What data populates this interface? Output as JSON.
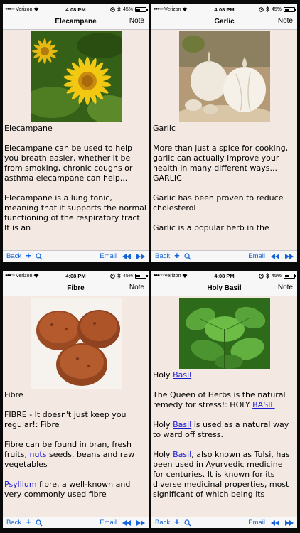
{
  "status": {
    "carrier": "Verizon",
    "time": "4:08 PM",
    "battery": "45%",
    "battery_level": 0.45
  },
  "toolbar": {
    "back": "Back",
    "email": "Email"
  },
  "nav": {
    "note": "Note"
  },
  "screens": [
    {
      "title": "Elecampane",
      "heading": "Elecampane",
      "paragraphs": [
        "Elecampane can be used to help you breath easier, whether it be from smoking, chronic coughs or asthma elecampane can help...",
        "Elecampane is a lung tonic, meaning that it supports the normal functioning of the respiratory tract. It is an"
      ]
    },
    {
      "title": "Garlic",
      "heading": "Garlic",
      "paragraphs": [
        "More than just a spice for cooking, garlic can actually improve your health in many different ways... GARLIC",
        "Garlic has been proven to reduce cholesterol",
        "Garlic is a popular herb in the"
      ]
    },
    {
      "title": "Fibre",
      "heading": "Fibre",
      "p1": "FIBRE - It doesn't just keep you regular!: Fibre",
      "p2_pre": "Fibre can be found in bran, fresh fruits, ",
      "p2_link": "nuts",
      "p2_post": " seeds, beans and raw vegetables",
      "p3_link": "Psyllium",
      "p3_post": " fibre, a well-known and very commonly used fibre"
    },
    {
      "title": "Holy Basil",
      "heading_pre": "Holy ",
      "heading_link": "Basil",
      "p1_pre": "The Queen of Herbs is the natural remedy for stress!: HOLY ",
      "p1_link": "BASIL",
      "p2_pre": "Holy ",
      "p2_link": "Basil",
      "p2_post": " is used as a natural way to ward off stress.",
      "p3_pre": "Holy ",
      "p3_link": "Basil",
      "p3_post": ", also known as Tulsi, has been used in Ayurvedic medicine for centuries. It is known for its diverse medicinal properties, most significant of which being its"
    }
  ],
  "icons": [
    "wifi-icon",
    "alarm-icon",
    "bluetooth-icon",
    "battery-icon",
    "plus-icon",
    "search-icon",
    "rewind-icon",
    "fast-forward-icon"
  ]
}
